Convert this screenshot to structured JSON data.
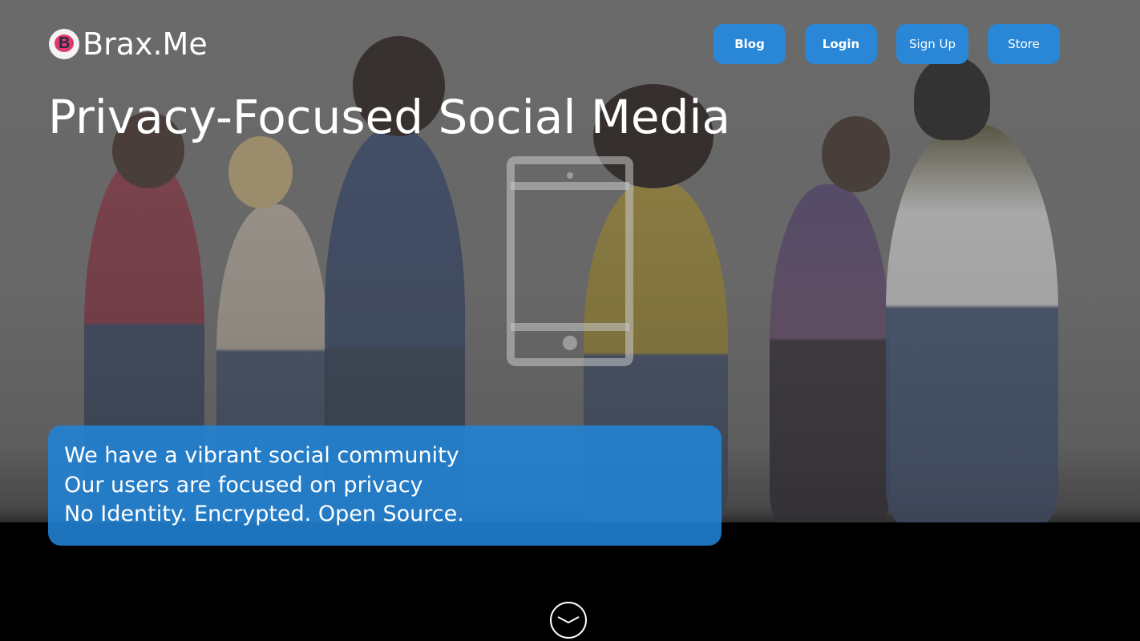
{
  "header": {
    "logo_text": "Brax.Me",
    "logo_icon": "brax-logo-icon"
  },
  "nav": {
    "blog": "Blog",
    "login": "Login",
    "signup": "Sign Up",
    "store": "Store"
  },
  "hero": {
    "headline": "Privacy-Focused Social Media",
    "device_icon": "tablet-icon",
    "info_lines": [
      "We have a vibrant social community",
      "Our users are focused on privacy",
      "No Identity. Encrypted. Open Source."
    ],
    "scroll_icon": "chevron-down-circle-icon"
  },
  "colors": {
    "accent": "#2a86d6",
    "text": "#ffffff",
    "background": "#000000"
  }
}
